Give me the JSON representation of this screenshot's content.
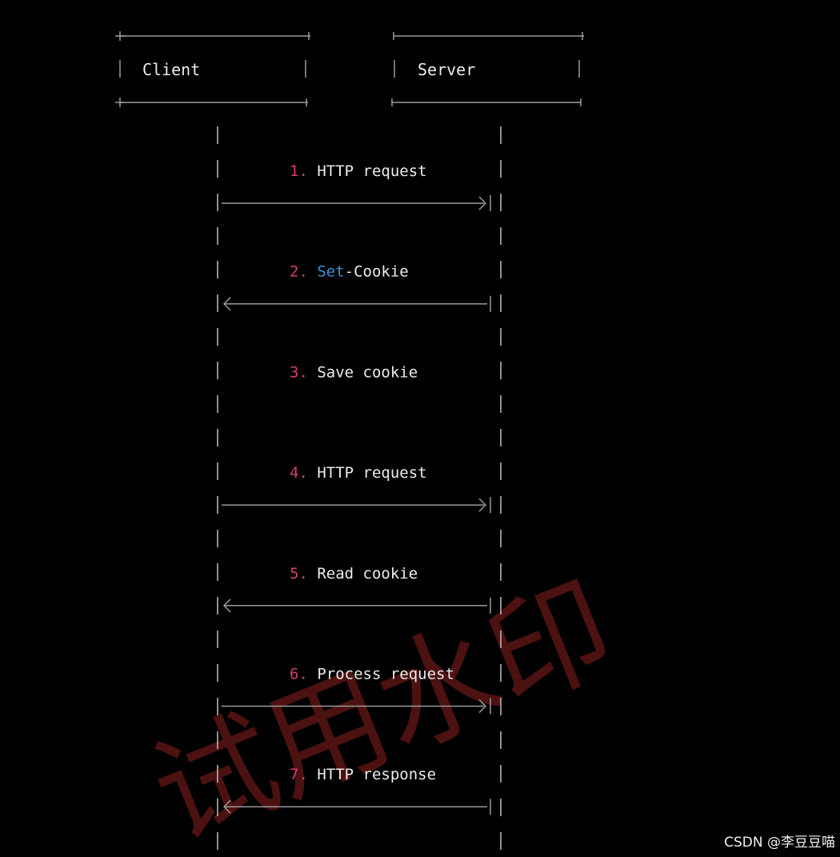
{
  "participants": {
    "client": "Client",
    "server": "Server"
  },
  "steps": [
    {
      "num": "1.",
      "text": "HTTP request",
      "direction": "to_server"
    },
    {
      "num": "2.",
      "keyword": "Set",
      "text": "-Cookie",
      "direction": "to_client"
    },
    {
      "num": "3.",
      "text": "Save cookie",
      "direction": "none"
    },
    {
      "num": "4.",
      "text": "HTTP request",
      "direction": "to_server"
    },
    {
      "num": "5.",
      "text": "Read cookie",
      "direction": "to_client"
    },
    {
      "num": "6.",
      "text": "Process request",
      "direction": "to_server"
    },
    {
      "num": "7.",
      "text": "HTTP response",
      "direction": "to_client"
    }
  ],
  "watermark": "试用水印",
  "attribution": "CSDN @李豆豆喵",
  "colors": {
    "background": "#000000",
    "text": "#ececec",
    "line": "#9a9a9a",
    "step_number": "#d63c7a",
    "keyword": "#3f8fd6",
    "watermark": "#5a1515"
  }
}
